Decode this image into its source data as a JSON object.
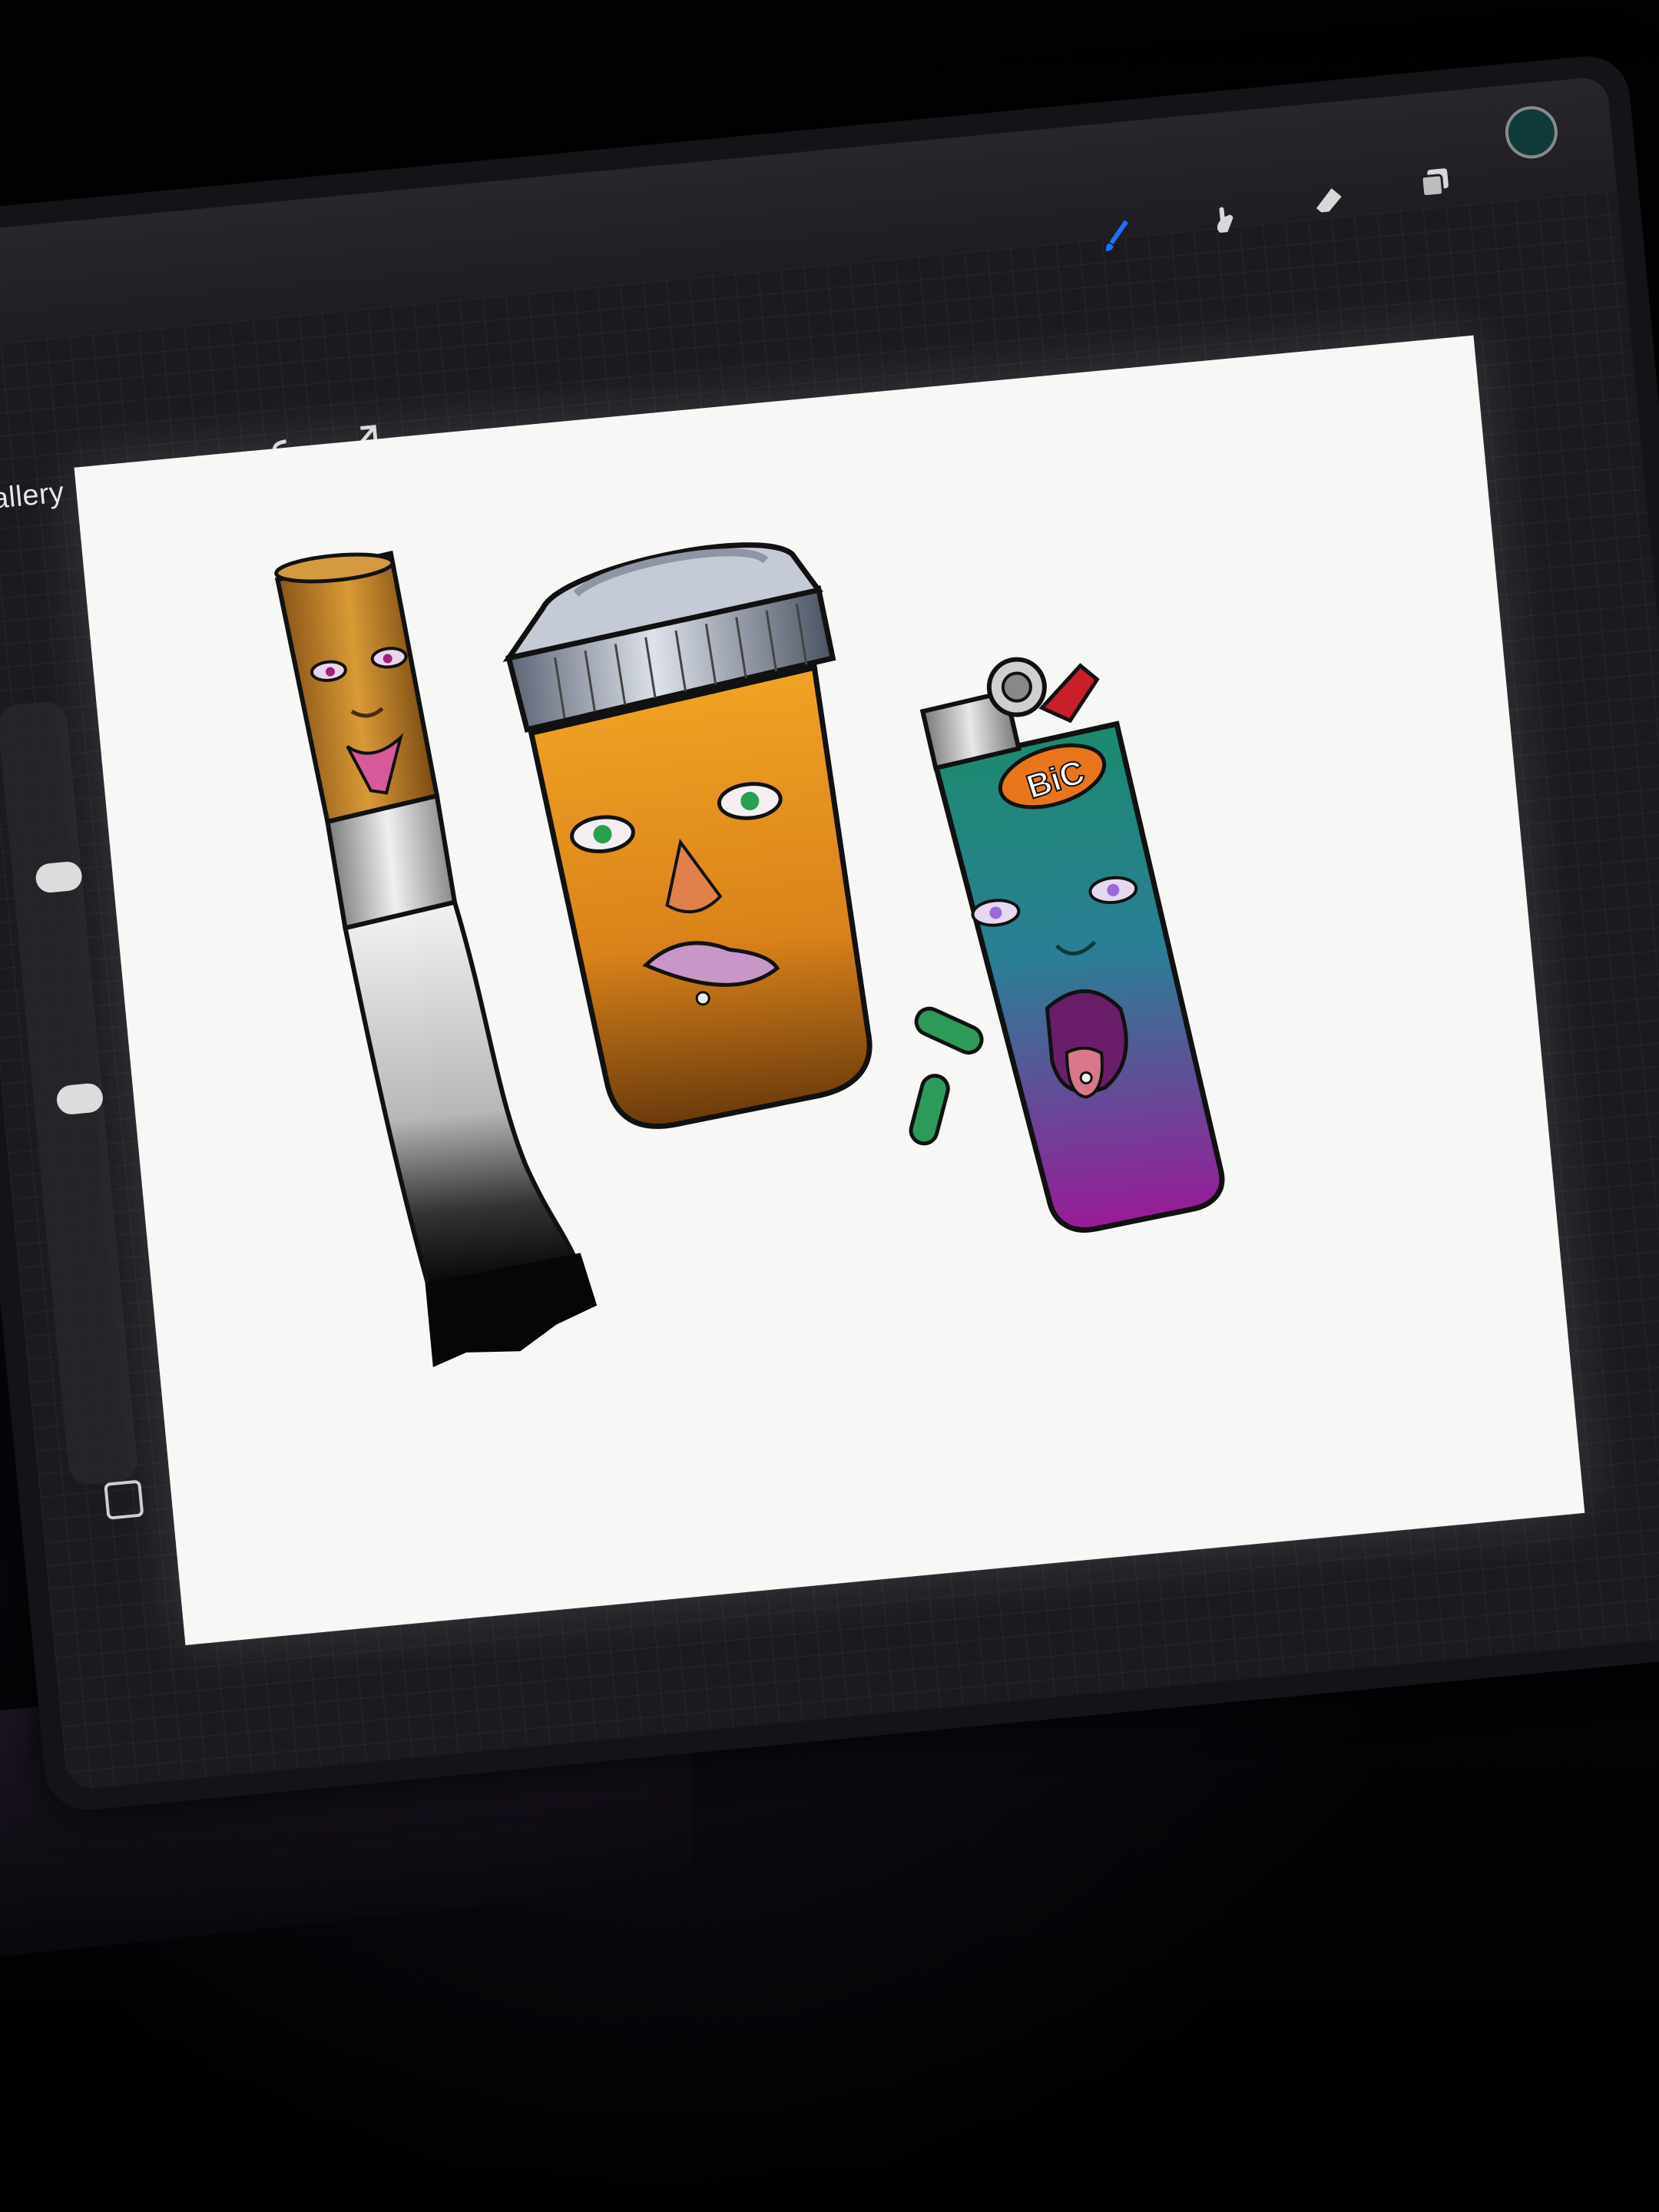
{
  "toolbar": {
    "gallery_label": "Gallery",
    "left_tools": [
      {
        "name": "wrench-icon"
      },
      {
        "name": "magic-wand-icon"
      },
      {
        "name": "selection-icon"
      },
      {
        "name": "transform-arrow-icon"
      }
    ],
    "right_tools": [
      {
        "name": "brush-icon",
        "active": true
      },
      {
        "name": "smudge-icon"
      },
      {
        "name": "eraser-icon"
      },
      {
        "name": "layers-icon"
      }
    ],
    "active_color": "#0f3a3b",
    "active_tool_color": "#1e6fff"
  },
  "canvas": {
    "artwork_text": "BiC",
    "palette": {
      "cigarette_filter": "#c98a2a",
      "pill_bottle": "#e39a1f",
      "bottle_cap": "#9aa3b3",
      "lighter_green": "#1f8a78",
      "lighter_purple": "#8a1f8f",
      "pill": "#2e9a5a"
    }
  }
}
